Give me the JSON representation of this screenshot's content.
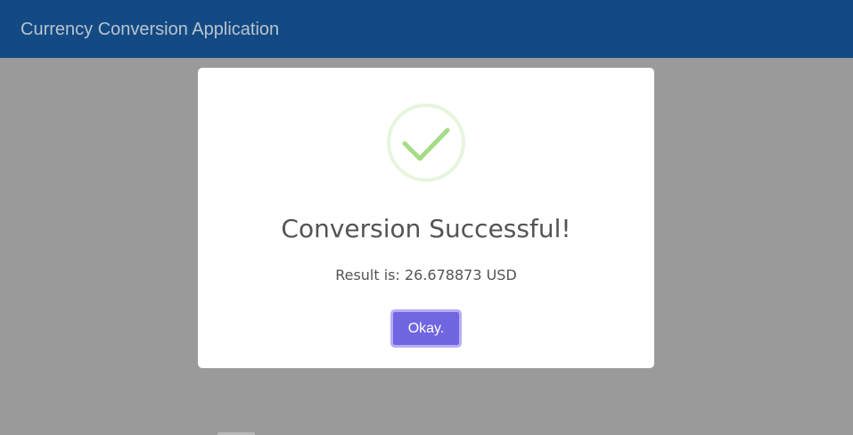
{
  "header": {
    "title": "Currency Conversion Application"
  },
  "dialog": {
    "icon": "check-icon",
    "title": "Conversion Successful!",
    "result_text": "Result is: 26.678873 USD",
    "confirm_label": "Okay."
  },
  "colors": {
    "header_background": "#134a84",
    "header_text": "#b9c3cf",
    "overlay": "#9a9a9a",
    "success_ring": "#e6f5dc",
    "success_check": "#a5dc86",
    "button_background": "#7066e0",
    "button_focus_ring": "#b7aefa",
    "dialog_text": "#545454"
  }
}
